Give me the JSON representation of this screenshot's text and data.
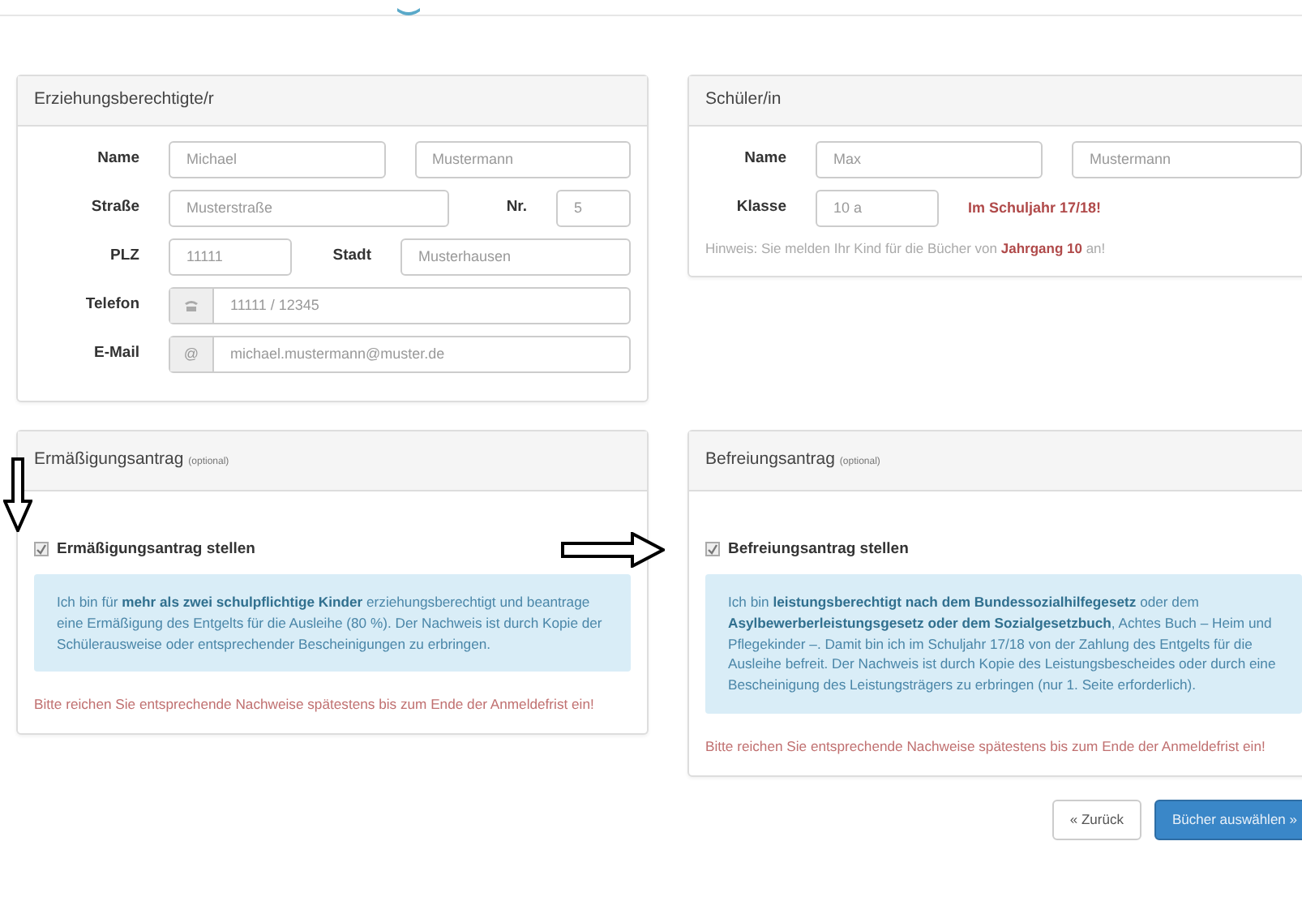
{
  "guardian": {
    "title": "Erziehungsberechtigte/r",
    "rows": [
      {
        "items": [
          {
            "kind": "label",
            "text": "Name"
          },
          {
            "kind": "field",
            "value": "Michael"
          },
          {
            "kind": "field",
            "value": "Mustermann"
          }
        ]
      },
      {
        "items": [
          {
            "kind": "label",
            "text": "Straße"
          },
          {
            "kind": "field",
            "value": "Musterstraße"
          },
          {
            "kind": "label",
            "text": "Nr."
          },
          {
            "kind": "field",
            "value": "5"
          }
        ]
      },
      {
        "items": [
          {
            "kind": "label",
            "text": "PLZ"
          },
          {
            "kind": "field",
            "value": "11111"
          },
          {
            "kind": "label",
            "text": "Stadt"
          },
          {
            "kind": "field",
            "value": "Musterhausen"
          }
        ]
      },
      {
        "items": [
          {
            "kind": "label",
            "text": "Telefon"
          },
          {
            "kind": "phone_field",
            "value": "11111 / 12345"
          }
        ]
      },
      {
        "items": [
          {
            "kind": "label",
            "text": "E-Mail"
          },
          {
            "kind": "at_field",
            "addon": "@",
            "value": "michael.mustermann@muster.de"
          }
        ]
      }
    ]
  },
  "student": {
    "title": "Schüler/in",
    "rows": [
      {
        "items": [
          {
            "kind": "label",
            "text": "Name"
          },
          {
            "kind": "field",
            "value": "Max"
          },
          {
            "kind": "field",
            "value": "Mustermann"
          }
        ]
      },
      {
        "items": [
          {
            "kind": "label",
            "text": "Klasse"
          },
          {
            "kind": "field",
            "value": "10 a"
          },
          {
            "kind": "note",
            "text": "Im Schuljahr 17/18!"
          }
        ]
      }
    ],
    "hint": "Hinweis: Sie melden Ihr Kind für die Bücher von **Jahrgang 10** an!"
  },
  "applications": [
    {
      "title": "Ermäßigungsantrag",
      "tag": "(optional)",
      "checkbox": {
        "label": "Ermäßigungsantrag stellen",
        "checked": true
      },
      "info": "Ich bin für **mehr als zwei schulpflichtige Kinder** erziehungsberechtigt und beantrage eine Ermäßigung des Entgelts für die Ausleihe (80 %). Der Nachweis ist durch Kopie der Schülerausweise oder entsprechender Bescheinigungen zu erbringen.",
      "warning": "Bitte reichen Sie entsprechende Nachweise spätestens bis zum Ende der Anmeldefrist ein!"
    },
    {
      "title": "Befreiungsantrag",
      "tag": "(optional)",
      "checkbox": {
        "label": "Befreiungsantrag stellen",
        "checked": true
      },
      "info": "Ich bin **leistungsberechtigt nach dem Bundessozialhilfegesetz** oder dem **Asylbewerberleistungsgesetz oder dem Sozialgesetzbuch**, Achtes Buch – Heim und Pflegekinder –. Damit bin ich im Schuljahr 17/18 von der Zahlung des Entgelts für die Ausleihe befreit. Der Nachweis ist durch Kopie des Leistungsbescheides oder durch eine Bescheinigung des Leistungsträgers zu erbringen (nur 1. Seite erforderlich).",
      "warning": "Bitte reichen Sie entsprechende Nachweise spätestens bis zum Ende der Anmeldefrist ein!"
    }
  ],
  "buttons": [
    {
      "kind": "secondary",
      "label": "« Zurück"
    },
    {
      "kind": "primary",
      "label": "Bücher auswählen »"
    }
  ]
}
